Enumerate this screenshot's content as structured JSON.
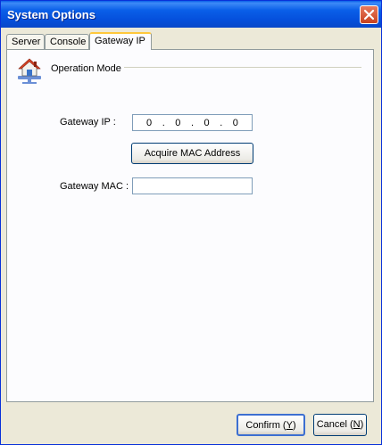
{
  "window": {
    "title": "System Options"
  },
  "tabs": [
    {
      "label": "Server"
    },
    {
      "label": "Console"
    },
    {
      "label": "Gateway IP"
    }
  ],
  "group": {
    "title": "Operation Mode",
    "icon": "home-network-icon"
  },
  "gateway_ip": {
    "label": "Gateway IP  :",
    "octets": [
      "0",
      "0",
      "0",
      "0"
    ],
    "separator": "."
  },
  "acquire_button": {
    "label": "Acquire MAC Address"
  },
  "gateway_mac": {
    "label": "Gateway MAC :",
    "value": ""
  },
  "footer": {
    "confirm_prefix": "Confirm (",
    "confirm_key": "Y",
    "confirm_suffix": ")",
    "cancel_prefix": "Cancel (",
    "cancel_key": "N",
    "cancel_suffix": ")"
  },
  "colors": {
    "titlebar": "#0a5fe8",
    "close": "#c8421e",
    "window_bg": "#ece9d8",
    "active_tab_highlight": "#ffc83c"
  }
}
